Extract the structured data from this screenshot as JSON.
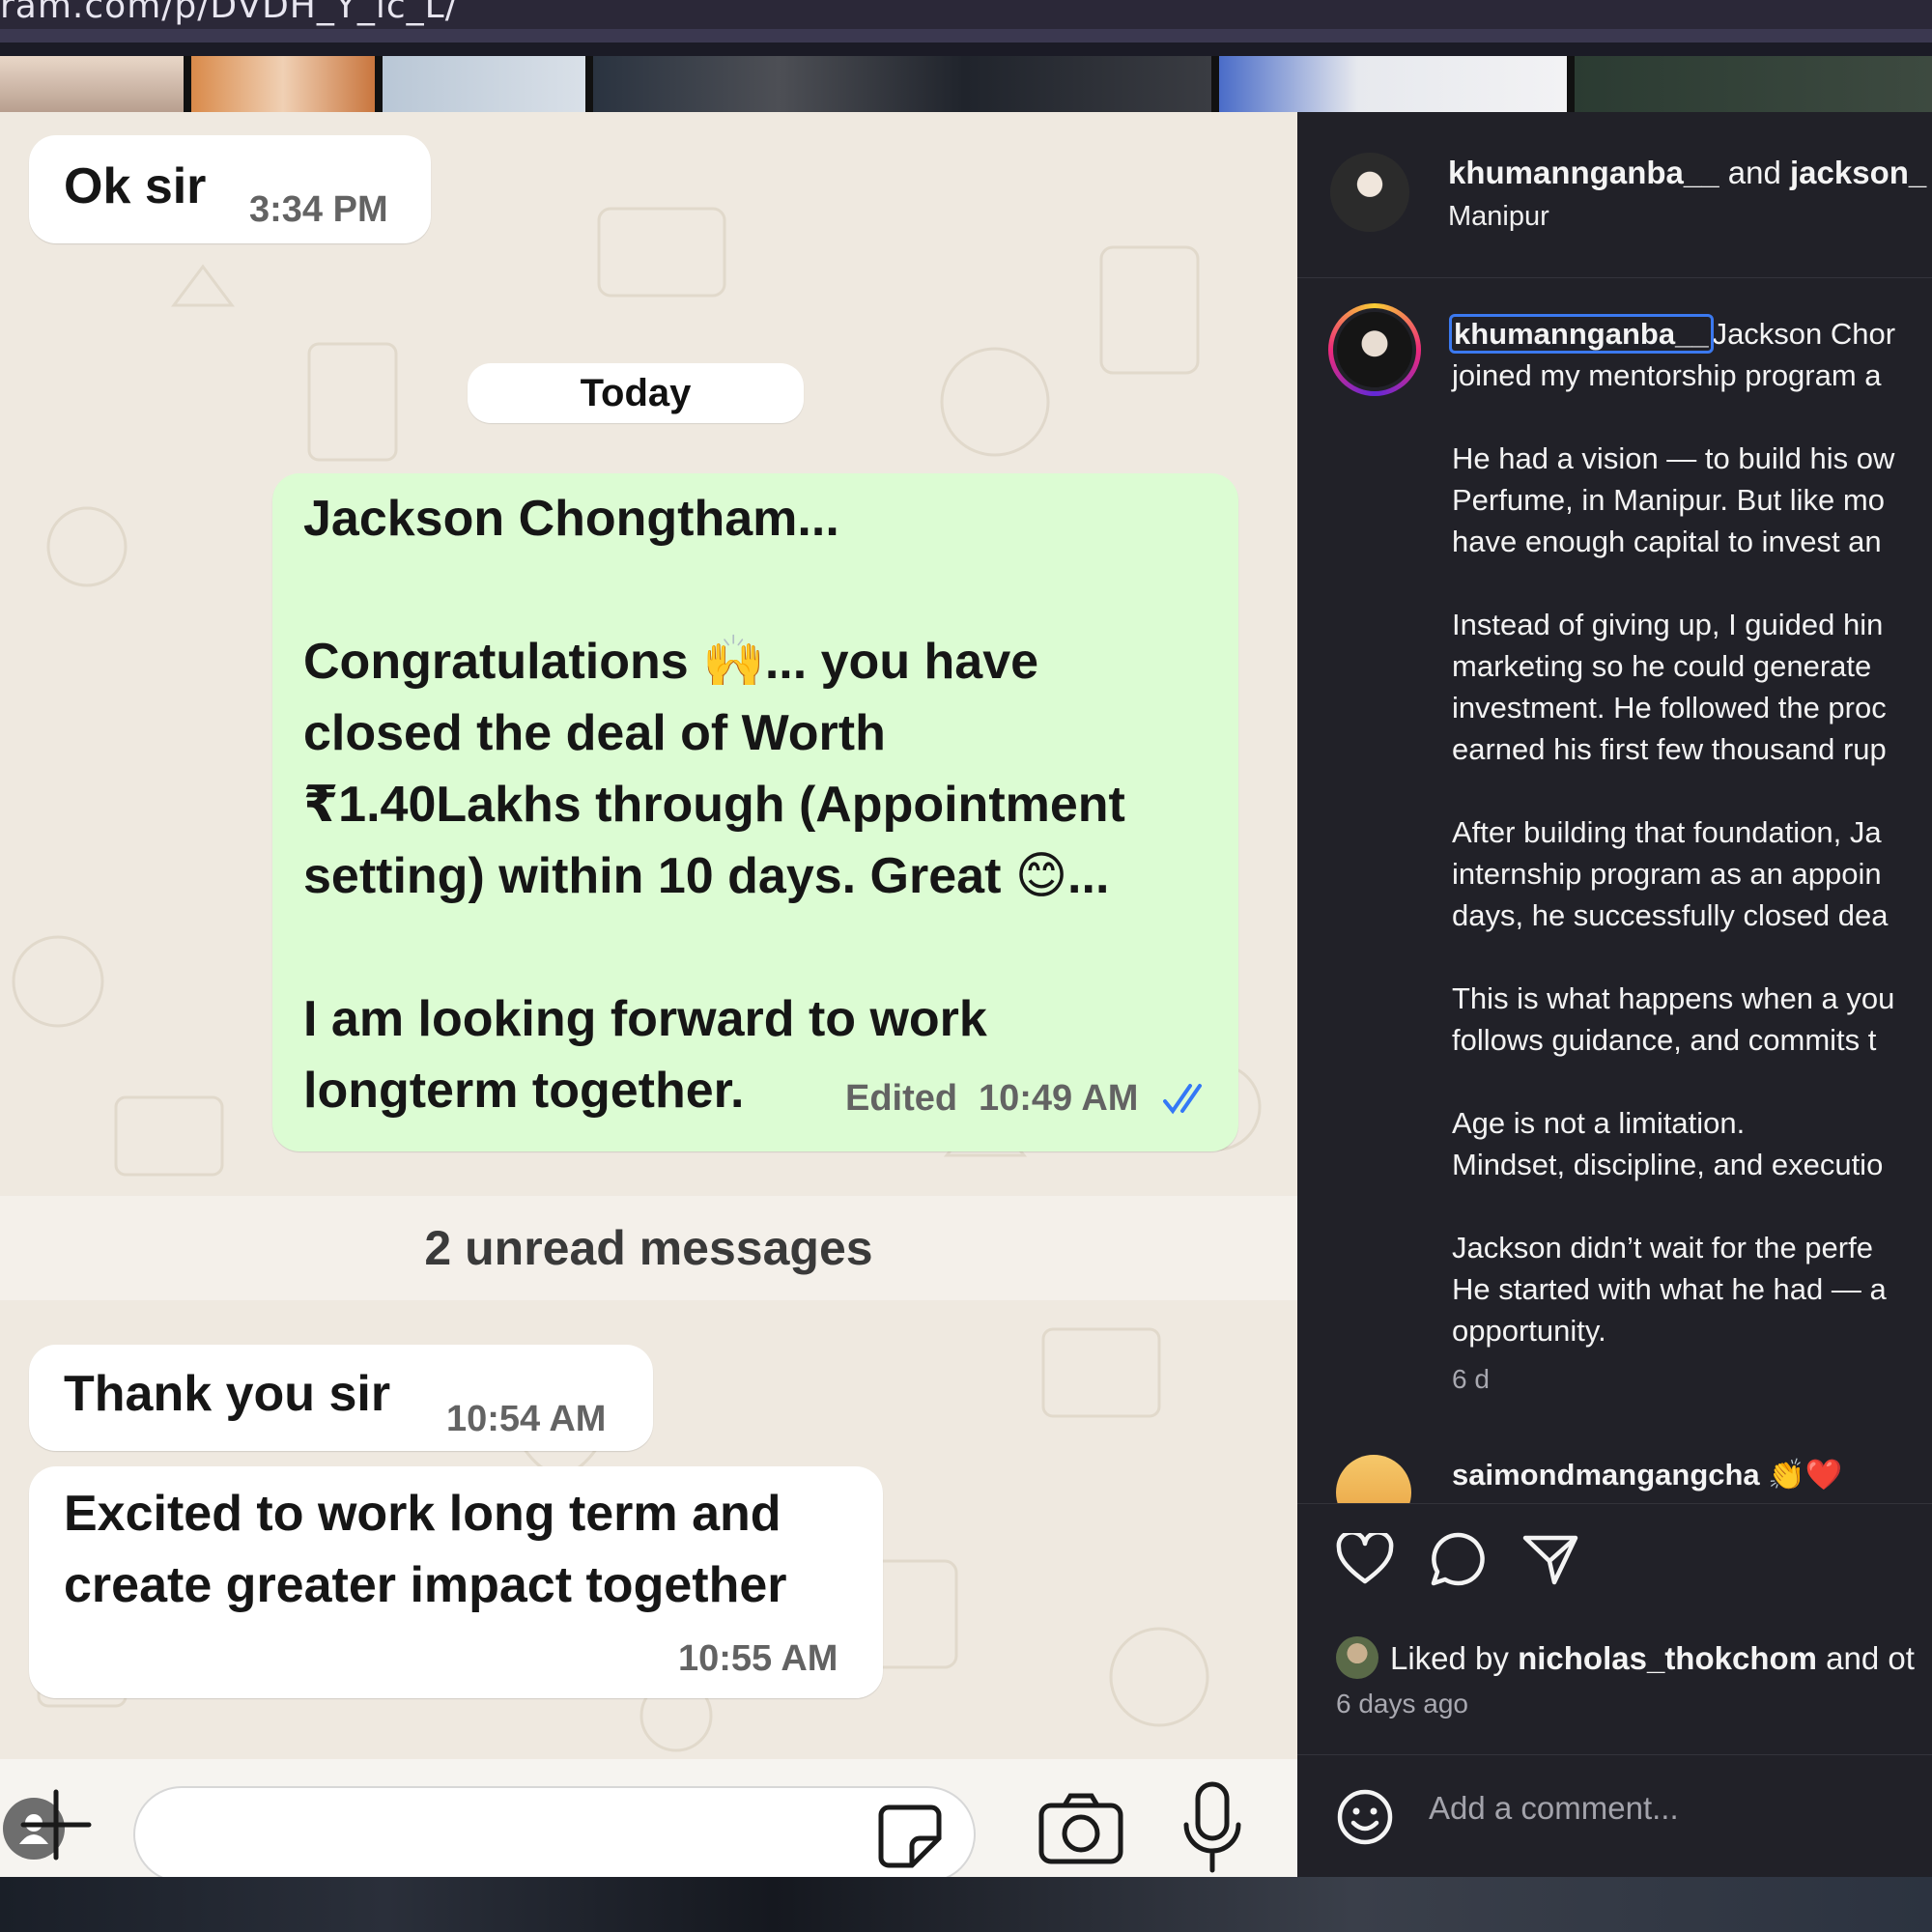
{
  "browser": {
    "url": "ram.com/p/DVDH_Y_ic_L/"
  },
  "whatsapp": {
    "messages": [
      {
        "text": "Ok sir",
        "time": "3:34 PM"
      },
      {
        "text": "Jackson Chongtham...\n\nCongratulations 🙌... you have\nclosed the deal of Worth\n₹1.40Lakhs through (Appointment\nsetting) within 10 days. Great 😊...\n\nI am looking forward to work\nlongterm together.",
        "status": "Edited",
        "time": "10:49 AM"
      },
      {
        "text": "Thank you sir",
        "time": "10:54 AM"
      },
      {
        "text": "Excited to work long term and\ncreate greater impact together",
        "time": "10:55 AM"
      }
    ],
    "day_label": "Today",
    "unread_label": "2 unread messages",
    "read_tick_color": "#3478f6",
    "bubble_out_color": "#dcfcd3"
  },
  "instagram": {
    "header": {
      "user1": "khumannganba__",
      "joiner": "and",
      "user2": "jackson_",
      "location": "Manipur"
    },
    "caption": {
      "username": "khumannganba__",
      "text": "Jackson Chor\njoined my mentorship program a\n\nHe had a vision — to build his ow\nPerfume, in Manipur. But like mo\nhave enough capital to invest an\n\nInstead of giving up, I guided hin\nmarketing so he could generate\ninvestment. He followed the proc\nearned his first few thousand rup\n\nAfter building that foundation, Ja\ninternship program as an appoin\ndays, he successfully closed dea\n\nThis is what happens when a you\nfollows guidance, and commits t\n\nAge is not a limitation.\nMindset, discipline, and executio\n\nJackson didn’t wait for the perfe\nHe started with what he had — a\nopportunity."
    },
    "caption_age": "6 d",
    "comment": {
      "user": "saimondmangangcha",
      "emoji": "👏❤️"
    },
    "liked": {
      "prefix": "Liked by",
      "user": "nicholas_thokchom",
      "suffix": "and ot"
    },
    "posted": "6 days ago",
    "comment_placeholder": "Add a comment..."
  }
}
